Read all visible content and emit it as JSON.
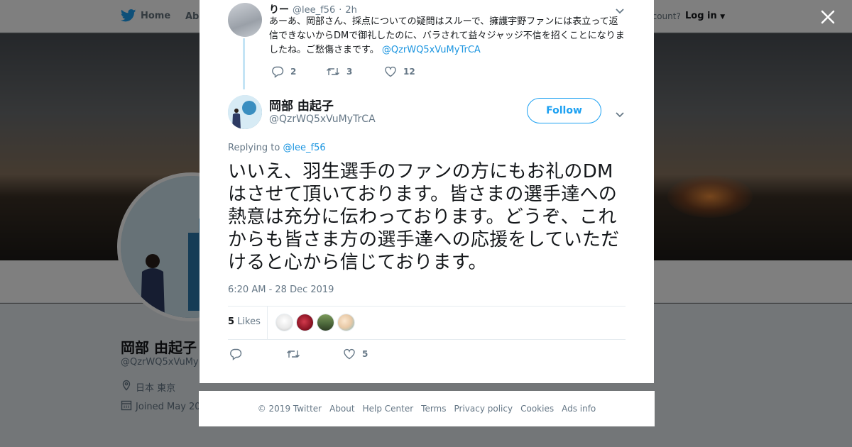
{
  "colors": {
    "brand": "#1da1f2",
    "link": "#1b95e0",
    "text": "#14171a",
    "muted": "#657786"
  },
  "nav": {
    "home_label": "Home",
    "about_label": "Abo",
    "account_prompt": "ccount?",
    "login_label": "Log in",
    "icons": [
      "twitter-bird-icon",
      "caret-down-icon"
    ]
  },
  "profile": {
    "name": "岡部 由起子",
    "handle": "@QzrWQ5xVuMy",
    "location": "日本 東京",
    "joined": "Joined May 20",
    "icons": [
      "location-pin-icon",
      "calendar-icon"
    ]
  },
  "parent_tweet": {
    "name": "りー",
    "handle": "@lee_f56",
    "separator": "·",
    "time": "2h",
    "text": "あーあ、岡部さん、採点についての疑問はスルーで、擁護宇野ファンには表立って返信できないからDMで御礼したのに、バラされて益々ジャッジ不信を招くことになりましたね。ご愁傷さまです。",
    "mention": "@QzrWQ5xVuMyTrCA",
    "reply_count": "2",
    "retweet_count": "3",
    "like_count": "12"
  },
  "tweet": {
    "name": "岡部 由起子",
    "handle": "@QzrWQ5xVuMyTrCA",
    "follow_label": "Follow",
    "replying_prefix": "Replying to",
    "replying_to": "@lee_f56",
    "text": "いいえ、羽生選手のファンの方にもお礼のDMはさせて頂いております。皆さまの選手達への熱意は充分に伝わっております。どうぞ、これからも皆さま方の選手達への応援をしていただけると心から信じております。",
    "timestamp": "6:20 AM - 28 Dec 2019",
    "likes_number": "5",
    "likes_label": "Likes",
    "like_count": "5",
    "liker_colors": [
      "#f2f2f2",
      "#a2172a",
      "#4f6b3d",
      "#e8c9a6"
    ]
  },
  "footer": {
    "copyright": "© 2019 Twitter",
    "links": [
      "About",
      "Help Center",
      "Terms",
      "Privacy policy",
      "Cookies",
      "Ads info"
    ]
  }
}
